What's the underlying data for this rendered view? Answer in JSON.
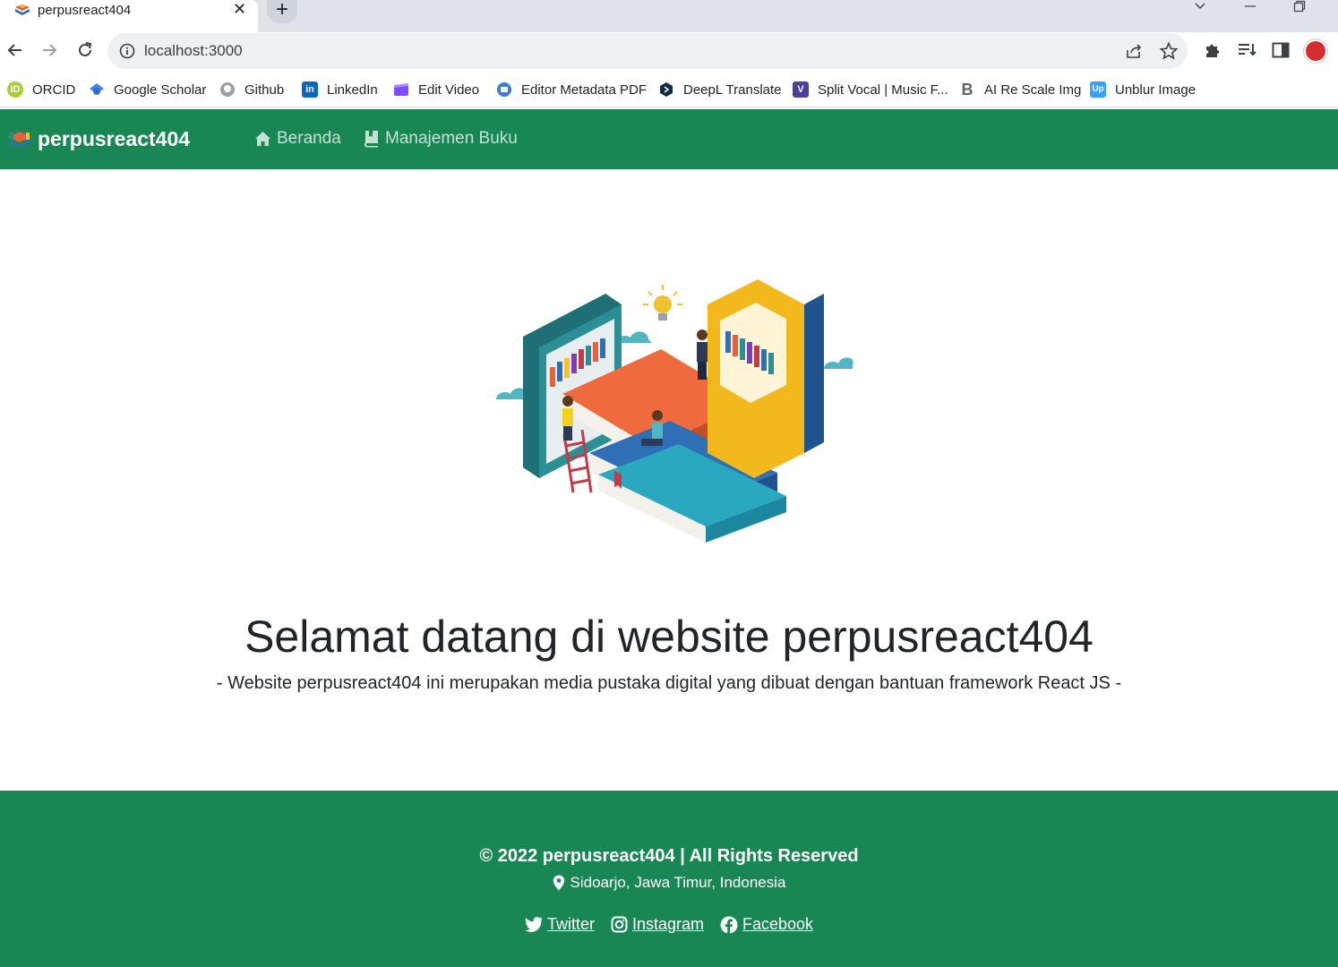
{
  "browser": {
    "tab_title": "perpusreact404",
    "tab_close": "✕",
    "new_tab": "+",
    "url": "localhost:3000",
    "bookmarks": [
      {
        "label": "ORCID",
        "icon": "orcid-icon",
        "color": "#a6ce39",
        "glyph": "iD"
      },
      {
        "label": "Google Scholar",
        "icon": "google-scholar-icon",
        "color": "#4285f4",
        "glyph": ""
      },
      {
        "label": "Github",
        "icon": "github-icon",
        "color": "#9aa0a6",
        "glyph": ""
      },
      {
        "label": "LinkedIn",
        "icon": "linkedin-icon",
        "color": "#0a66c2",
        "glyph": "in"
      },
      {
        "label": "Edit Video",
        "icon": "edit-video-icon",
        "color": "#7c4dff",
        "glyph": ""
      },
      {
        "label": "Editor Metadata PDF",
        "icon": "editor-metadata-icon",
        "color": "#3d7bd9",
        "glyph": ""
      },
      {
        "label": "DeepL Translate",
        "icon": "deepl-icon",
        "color": "#0f2b46",
        "glyph": ""
      },
      {
        "label": "Split Vocal | Music F...",
        "icon": "split-vocal-icon",
        "color": "#4b3f9e",
        "glyph": "V"
      },
      {
        "label": "AI Re Scale Img",
        "icon": "ai-rescale-icon",
        "color": "#ffffff",
        "glyph": "B"
      },
      {
        "label": "Unblur Image",
        "icon": "unblur-icon",
        "color": "#3aa0ff",
        "glyph": "Up"
      }
    ]
  },
  "navbar": {
    "brand": "perpusreact404",
    "links": [
      {
        "label": "Beranda",
        "icon": "home-icon"
      },
      {
        "label": "Manajemen Buku",
        "icon": "book-icon"
      }
    ],
    "color": "#198754"
  },
  "hero": {
    "title": "Selamat datang di website perpusreact404",
    "subtitle": "- Website perpusreact404 ini merupakan media pustaka digital yang dibuat dengan bantuan framework React JS -"
  },
  "footer": {
    "copyright": "© 2022 perpusreact404 | All Rights Reserved",
    "location": "Sidoarjo, Jawa Timur, Indonesia",
    "social": [
      {
        "label": "Twitter",
        "icon": "twitter-icon"
      },
      {
        "label": "Instagram",
        "icon": "instagram-icon"
      },
      {
        "label": "Facebook",
        "icon": "facebook-icon"
      }
    ]
  }
}
